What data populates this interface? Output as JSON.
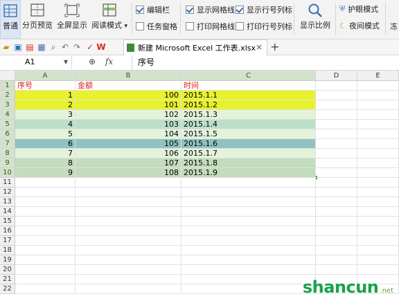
{
  "ribbon": {
    "view_buttons": [
      "普通",
      "分页预览",
      "全屏显示",
      "阅读模式"
    ],
    "reading_mode_arrow": "▾",
    "checks": [
      {
        "label": "编辑栏",
        "checked": true
      },
      {
        "label": "任务窗格",
        "checked": false
      },
      {
        "label": "显示网格线",
        "checked": true
      },
      {
        "label": "打印网格线",
        "checked": false
      },
      {
        "label": "显示行号列标",
        "checked": true
      },
      {
        "label": "打印行号列标",
        "checked": false
      }
    ],
    "zoom_label": "显示比例",
    "eye_mode": "护眼模式",
    "night_mode": "夜间模式",
    "cut_label": "冻"
  },
  "tabbar": {
    "doc_title": "新建 Microsoft Excel 工作表.xlsx",
    "close": "×",
    "new_tab": "+"
  },
  "formula_bar": {
    "cell_ref": "A1",
    "fx": "fx",
    "content": "序号"
  },
  "sheet": {
    "columns": [
      "A",
      "B",
      "C",
      "D",
      "E"
    ],
    "row_numbers": [
      "1",
      "2",
      "3",
      "4",
      "5",
      "6",
      "7",
      "8",
      "9",
      "10",
      "11",
      "12",
      "13",
      "14",
      "15",
      "16",
      "17",
      "18",
      "19",
      "20",
      "21",
      "22"
    ],
    "headers": [
      "序号",
      "金额",
      "时间"
    ],
    "rows": [
      {
        "seq": "1",
        "amount": "100",
        "date": "2015.1.1",
        "fill": "#e8f22a"
      },
      {
        "seq": "2",
        "amount": "101",
        "date": "2015.1.2",
        "fill": "#e8f22a"
      },
      {
        "seq": "3",
        "amount": "102",
        "date": "2015.1.3",
        "fill": "#e2f3da"
      },
      {
        "seq": "4",
        "amount": "103",
        "date": "2015.1.4",
        "fill": "#bcdfc9"
      },
      {
        "seq": "5",
        "amount": "104",
        "date": "2015.1.5",
        "fill": "#e2f3da"
      },
      {
        "seq": "6",
        "amount": "105",
        "date": "2015.1.6",
        "fill": "#8fc2c0"
      },
      {
        "seq": "7",
        "amount": "106",
        "date": "2015.1.7",
        "fill": "#e2f3da"
      },
      {
        "seq": "8",
        "amount": "107",
        "date": "2015.1.8",
        "fill": "#c3dcbb"
      },
      {
        "seq": "9",
        "amount": "108",
        "date": "2015.1.9",
        "fill": "#c3dcbb"
      }
    ]
  },
  "watermark": {
    "main": "shancun",
    "sub": ".net"
  },
  "colors": {
    "header_text": "#e0201b",
    "selection_border": "#3f8a3a"
  }
}
